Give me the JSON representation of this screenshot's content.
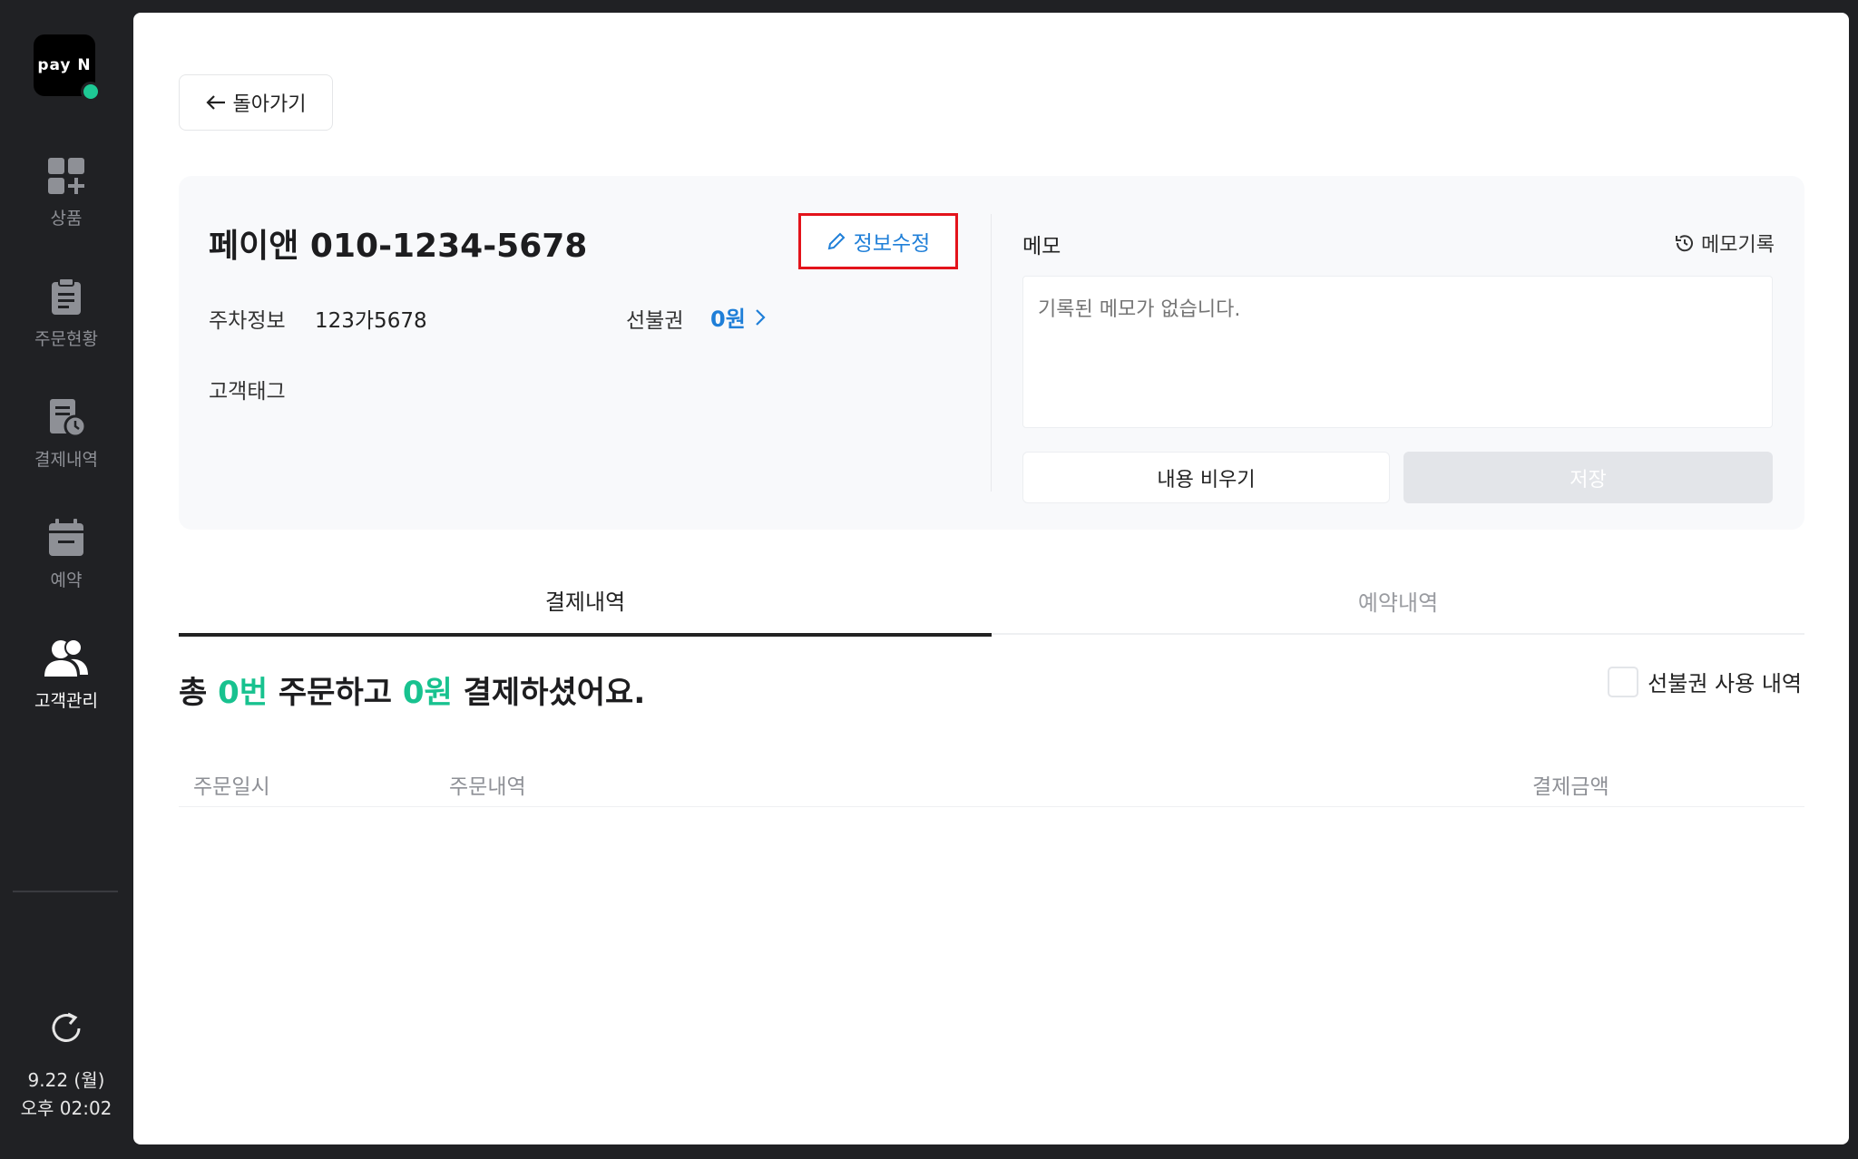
{
  "sidebar": {
    "logo_text": "pay N",
    "items": [
      {
        "label": "상품",
        "icon": "product-grid-icon"
      },
      {
        "label": "주문현황",
        "icon": "clipboard-icon"
      },
      {
        "label": "결제내역",
        "icon": "receipt-clock-icon"
      },
      {
        "label": "예약",
        "icon": "calendar-icon"
      },
      {
        "label": "고객관리",
        "icon": "users-icon"
      }
    ],
    "active_item": "고객관리",
    "date": "9.22 (월)",
    "time": "오후 02:02"
  },
  "back_button": {
    "label": "돌아가기",
    "icon": "arrow-left-icon"
  },
  "customer": {
    "name": "페이앤",
    "phone": "010-1234-5678",
    "edit_label": "정보수정",
    "parking_label": "주차정보",
    "parking_value": "123가5678",
    "prepaid_label": "선불권",
    "prepaid_value": "0원",
    "tag_label": "고객태그"
  },
  "memo": {
    "title": "메모",
    "history_label": "메모기록",
    "placeholder": "기록된 메모가 없습니다.",
    "clear_label": "내용 비우기",
    "save_label": "저장"
  },
  "tabs": [
    {
      "label": "결제내역",
      "active": true
    },
    {
      "label": "예약내역",
      "active": false
    }
  ],
  "summary": {
    "prefix": "총 ",
    "count": "0번",
    "middle": " 주문하고 ",
    "amount": "0원",
    "suffix": " 결제하셨어요."
  },
  "prepaid_filter": {
    "label": "선불권 사용 내역",
    "checked": false
  },
  "table": {
    "columns": [
      "주문일시",
      "주문내역",
      "결제금액"
    ],
    "rows": []
  },
  "colors": {
    "accent_green": "#18c28f",
    "link_blue": "#1f7fd8",
    "highlight_red": "#e3131b",
    "sidebar_bg": "#202124"
  }
}
